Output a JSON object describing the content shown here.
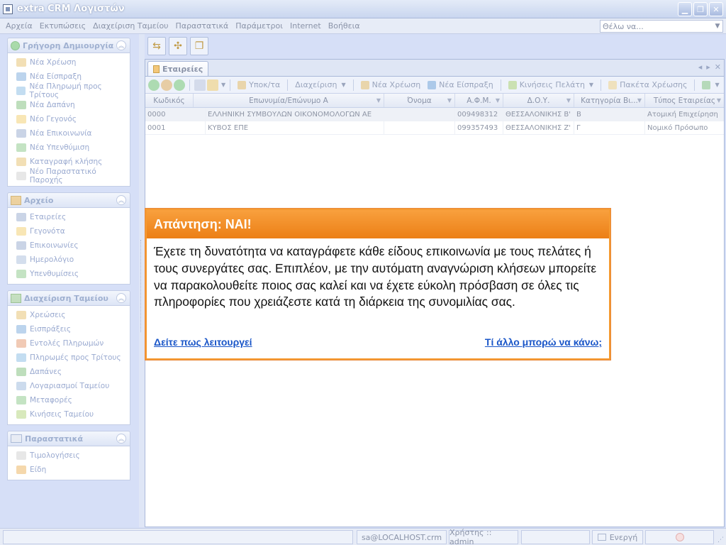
{
  "window": {
    "title": "extra CRM Λογιστών"
  },
  "menu": [
    "Αρχεία",
    "Εκτυπώσεις",
    "Διαχείριση Ταμείου",
    "Παραστατικά",
    "Παράμετροι",
    "Internet",
    "Βοήθεια"
  ],
  "search": {
    "placeholder": "Θέλω να..."
  },
  "sidebar": {
    "groups": [
      {
        "title": "Γρήγορη Δημιουργία",
        "items": [
          "Νέα Χρέωση",
          "Νέα Είσπραξη",
          "Νέα Πληρωμή προς Τρίτους",
          "Νέα Δαπάνη",
          "Νέο Γεγονός",
          "Νέα Επικοινωνία",
          "Νέα Υπενθύμιση",
          "Καταγραφή κλήσης",
          "Νέο Παραστατικό Παροχής"
        ]
      },
      {
        "title": "Αρχείο",
        "items": [
          "Εταιρείες",
          "Γεγονότα",
          "Επικοινωνίες",
          "Ημερολόγιο",
          "Υπενθυμίσεις"
        ]
      },
      {
        "title": "Διαχείριση Ταμείου",
        "items": [
          "Χρεώσεις",
          "Εισπράξεις",
          "Εντολές Πληρωμών",
          "Πληρωμές προς Τρίτους",
          "Δαπάνες",
          "Λογαριασμοί Ταμείου",
          "Μεταφορές",
          "Κινήσεις Ταμείου"
        ]
      },
      {
        "title": "Παραστατικά",
        "items": [
          "Τιμολογήσεις",
          "Είδη"
        ]
      }
    ]
  },
  "document": {
    "tab": "Εταιρείες",
    "toolbar": {
      "subcategories": "Υποκ/τα",
      "manage": "Διαχείριση",
      "new_charge": "Νέα Χρέωση",
      "new_receipt": "Νέα Είσπραξη",
      "client_moves": "Κινήσεις Πελάτη",
      "charge_packages": "Πακέτα Χρέωσης"
    },
    "columns": [
      "Κωδικός",
      "Επωνυμία/Επώνυμο Α",
      "Όνομα",
      "Α.Φ.Μ.",
      "Δ.Ο.Υ.",
      "Κατηγορία Βι...",
      "Τύπος Εταιρείας"
    ],
    "rows": [
      [
        "0000",
        "ΕΛΛΗΝΙΚΗ ΣΥΜΒΟΥΛΩΝ ΟΙΚΟΝΟΜΟΛΟΓΩΝ ΑΕ",
        "",
        "009498312",
        "ΘΕΣΣΑΛΟΝΙΚΗΣ Β'",
        "Β",
        "Ατομική Επιχείρηση"
      ],
      [
        "0001",
        "ΚΥΒΟΣ ΕΠΕ",
        "",
        "099357493",
        "ΘΕΣΣΑΛΟΝΙΚΗΣ Ζ'",
        "Γ",
        "Νομικό Πρόσωπο"
      ]
    ]
  },
  "popup": {
    "title": "Απάντηση: ΝΑΙ!",
    "body": "Έχετε τη δυνατότητα να καταγράφετε κάθε είδους επικοινωνία με τους πελάτες ή τους συνεργάτες σας. Επιπλέον, με την αυτόματη αναγνώριση κλήσεων μπορείτε να παρακολουθείτε ποιος σας καλεί και να έχετε εύκολη πρόσβαση σε όλες τις πληροφορίες που χρειάζεστε κατά τη διάρκεια της συνομιλίας σας.",
    "link_left": "Δείτε πως λειτουργεί",
    "link_right": "Τί άλλο μπορώ να κάνω;"
  },
  "status": {
    "db": "sa@LOCALHOST.crm",
    "user": "Χρήστης :: admin",
    "state": "Ενεργή"
  },
  "colors": {
    "accent": "#F08A24",
    "link": "#1A56C8",
    "panel": "#D6DFF7"
  }
}
